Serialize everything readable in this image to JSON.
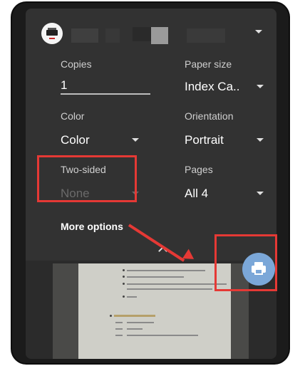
{
  "settings": {
    "copies": {
      "label": "Copies",
      "value": "1"
    },
    "paper_size": {
      "label": "Paper size",
      "value": "Index Ca.."
    },
    "color": {
      "label": "Color",
      "value": "Color"
    },
    "orientation": {
      "label": "Orientation",
      "value": "Portrait"
    },
    "two_sided": {
      "label": "Two-sided",
      "value": "None"
    },
    "pages": {
      "label": "Pages",
      "value": "All 4"
    }
  },
  "more_options": "More options",
  "icons": {
    "printer_avatar": "printer-avatar-icon",
    "header_dropdown": "chevron-down-icon",
    "expand": "chevron-up-icon",
    "print_fab": "print-icon"
  },
  "colors": {
    "panel_bg": "#323232",
    "fab": "#7ba7d8",
    "annotation": "#e53935"
  }
}
